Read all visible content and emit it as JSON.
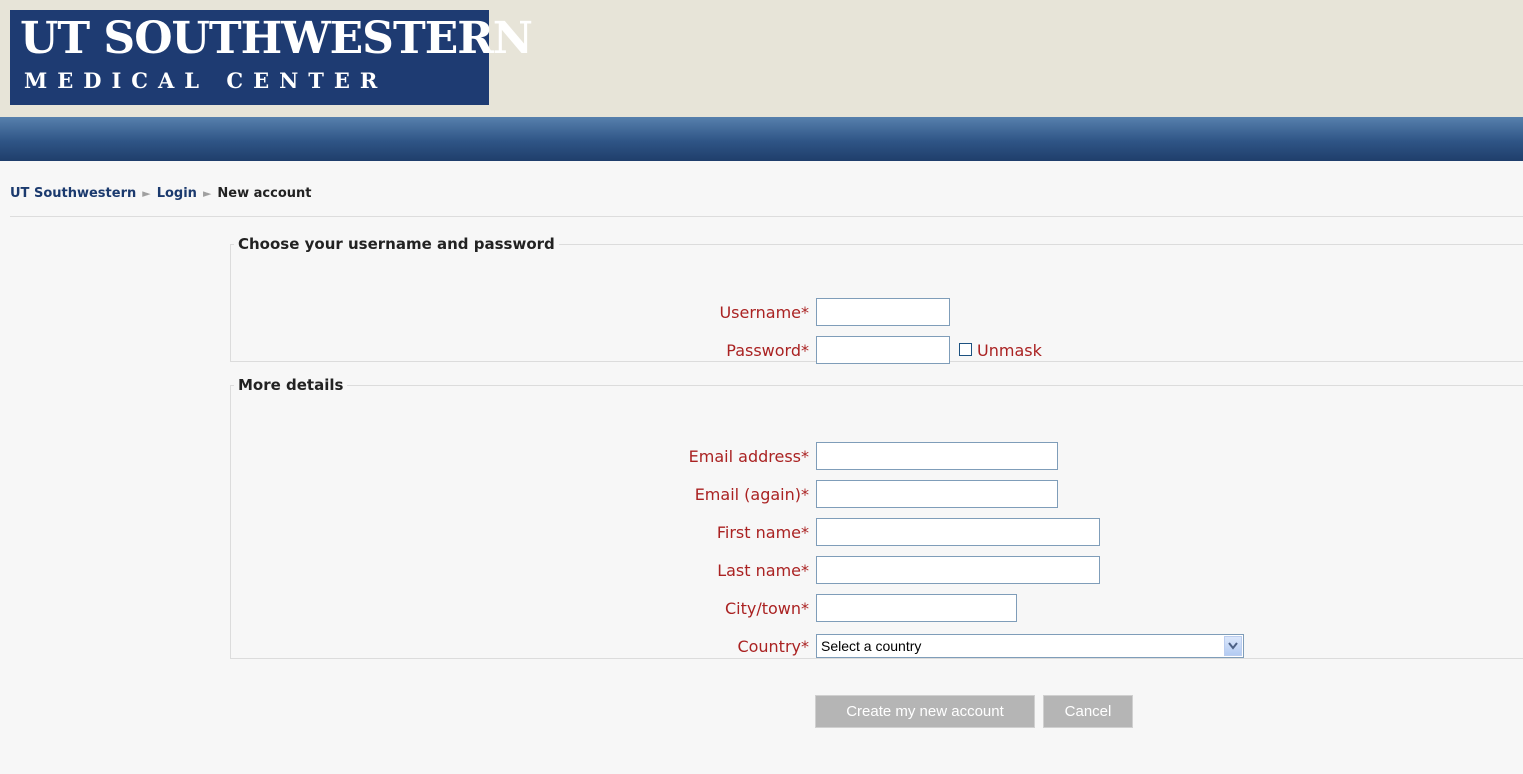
{
  "logo": {
    "line1": "UT SOUTHWESTERN",
    "line2": "MEDICAL CENTER"
  },
  "breadcrumb": {
    "home": "UT Southwestern",
    "login": "Login",
    "current": "New account",
    "separator": "►"
  },
  "section1": {
    "legend": "Choose your username and password",
    "username_label": "Username*",
    "password_label": "Password*",
    "unmask_label": "Unmask"
  },
  "section2": {
    "legend": "More details",
    "email_label": "Email address*",
    "email_again_label": "Email (again)*",
    "first_name_label": "First name*",
    "last_name_label": "Last name*",
    "city_label": "City/town*",
    "country_label": "Country*",
    "country_value": "Select a country"
  },
  "buttons": {
    "create": "Create my new account",
    "cancel": "Cancel"
  },
  "colors": {
    "required_label": "#aa2222",
    "logo_bg": "#1e3b72",
    "header_bg": "#e7e4d8",
    "button_bg": "#b5b5b5"
  }
}
